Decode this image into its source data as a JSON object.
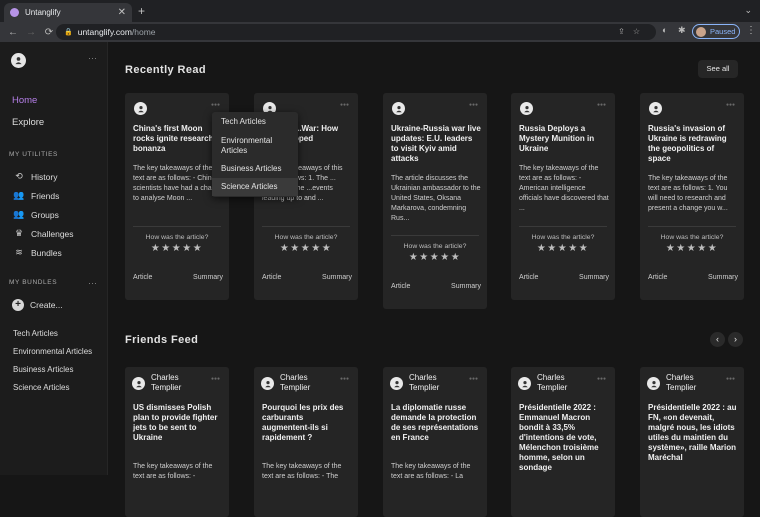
{
  "browser": {
    "tab_title": "Untanglify",
    "close_glyph": "✕",
    "new_tab_glyph": "+",
    "tab_menu_glyph": "⌄",
    "back_glyph": "←",
    "forward_glyph": "→",
    "reload_glyph": "⟳",
    "url_host": "untanglify.com",
    "url_path": "/home",
    "profile_label": "Paused",
    "menu_glyph": "⋮"
  },
  "sidebar": {
    "dots": "···",
    "home_label": "Home",
    "explore_label": "Explore",
    "utilities_heading": "MY UTILITIES",
    "utilities": [
      {
        "label": "History",
        "icon": "history-icon",
        "glyph": "⟲"
      },
      {
        "label": "Friends",
        "icon": "friends-icon",
        "glyph": "👥"
      },
      {
        "label": "Groups",
        "icon": "groups-icon",
        "glyph": "👥"
      },
      {
        "label": "Challenges",
        "icon": "crown-icon",
        "glyph": "♛"
      },
      {
        "label": "Bundles",
        "icon": "bundles-icon",
        "glyph": "≋"
      }
    ],
    "bundles_heading": "MY BUNDLES",
    "create_plus": "+",
    "create_label": "Create...",
    "bundles": [
      "Tech Articles",
      "Environmental Articles",
      "Business Articles",
      "Science Articles"
    ]
  },
  "recently_read": {
    "title": "Recently Read",
    "see_all": "See all",
    "question": "How was the article?",
    "stars": "★★★★★",
    "article_label": "Article",
    "summary_label": "Summary",
    "cards": [
      {
        "title": "China's first Moon rocks ignite research bonanza",
        "body": "The key takeaways of the text are as follows: - Chinese scientists have had a chance to analyse Moon ..."
      },
      {
        "title": "... of the ...War: How the ...veloped",
        "body": "The key takeaways of this ...e as follows: 1. The ... discusses the ...events leading up to and ..."
      },
      {
        "title": "Ukraine-Russia war live updates: E.U. leaders to visit Kyiv amid attacks",
        "body": "The article discusses the Ukrainian ambassador to the United States, Oksana Markarova, condemning Rus..."
      },
      {
        "title": "Russia Deploys a Mystery Munition in Ukraine",
        "body": "The key takeaways of the text are as follows: - American intelligence officials have discovered that ..."
      },
      {
        "title": "Russia's invasion of Ukraine is redrawing the geopolitics of space",
        "body": "The key takeaways of the text are as follows: 1. You will need to research and present a change you w..."
      }
    ]
  },
  "bundle_menu": {
    "items": [
      "Tech Articles",
      "Environmental Articles",
      "Business Articles",
      "Science Articles"
    ]
  },
  "friends_feed": {
    "title": "Friends Feed",
    "prev_glyph": "‹",
    "next_glyph": "›",
    "cards": [
      {
        "author": "Charles Templier",
        "title": "US dismisses Polish plan to provide fighter jets to be sent to Ukraine",
        "body": "The key takeaways of the text are as follows: -"
      },
      {
        "author": "Charles Templier",
        "title": "Pourquoi les prix des carburants augmentent-ils si rapidement ?",
        "body": "The key takeaways of the text are as follows: - The"
      },
      {
        "author": "Charles Templier",
        "title": "La diplomatie russe demande la protection de ses représentations en France",
        "body": "The key takeaways of the text are as follows: - La"
      },
      {
        "author": "Charles Templier",
        "title": "Présidentielle 2022 : Emmanuel Macron bondit à 33,5% d'intentions de vote, Mélenchon troisième homme, selon un sondage",
        "body": ""
      },
      {
        "author": "Charles Templier",
        "title": "Présidentielle 2022 : au FN, «on devenait, malgré nous, les idiots utiles du maintien du système», raille Marion Maréchal",
        "body": ""
      }
    ]
  },
  "colors": {
    "accent": "#b57fe8",
    "background": "#161616",
    "card": "#252525"
  }
}
